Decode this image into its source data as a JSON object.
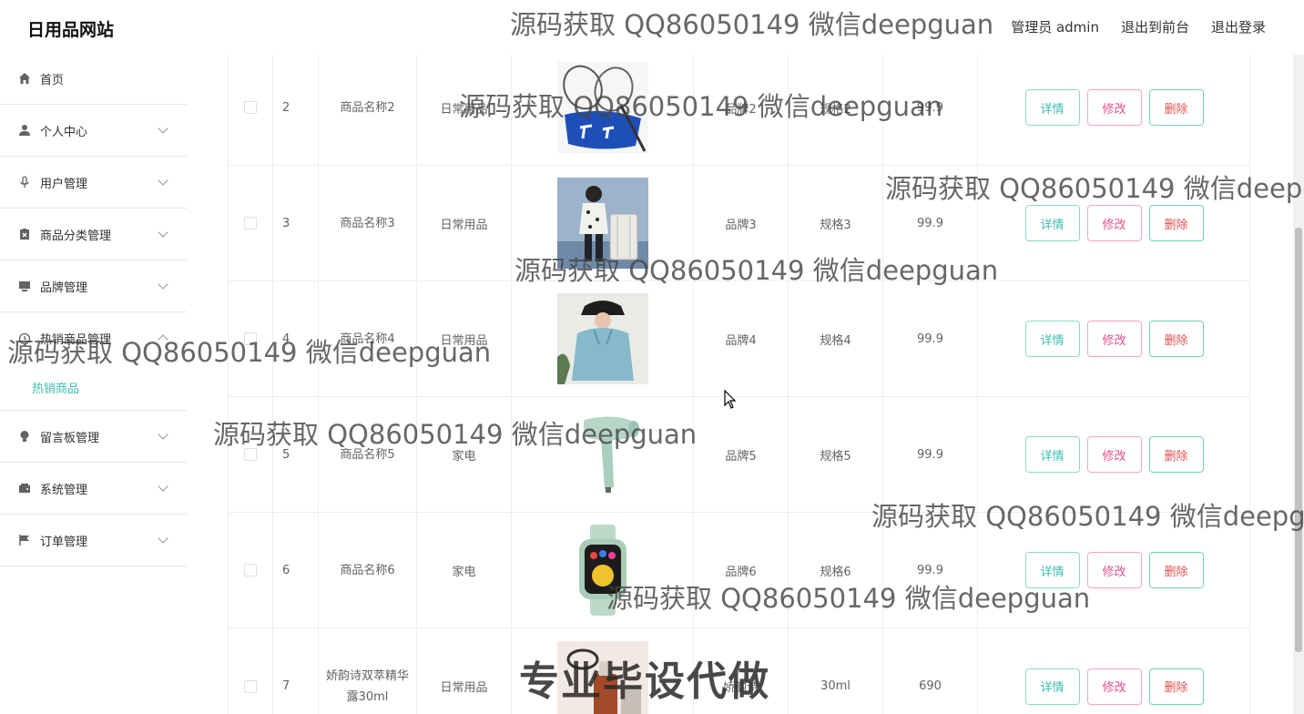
{
  "header": {
    "site_title": "日用品网站",
    "admin_label": "管理员 admin",
    "front_link": "退出到前台",
    "logout_link": "退出登录"
  },
  "sidebar": {
    "items": [
      {
        "label": "首页",
        "icon": "home-icon"
      },
      {
        "label": "个人中心",
        "icon": "user-icon"
      },
      {
        "label": "用户管理",
        "icon": "microphone-icon"
      },
      {
        "label": "商品分类管理",
        "icon": "clipboard-icon"
      },
      {
        "label": "品牌管理",
        "icon": "monitor-icon"
      },
      {
        "label": "热销商品管理",
        "icon": "clock-icon",
        "sub_items": [
          "热销商品"
        ]
      },
      {
        "label": "留言板管理",
        "icon": "lightbulb-icon"
      },
      {
        "label": "系统管理",
        "icon": "wallet-icon"
      },
      {
        "label": "订单管理",
        "icon": "flag-icon"
      }
    ]
  },
  "table": {
    "rows": [
      {
        "index": "2",
        "name": "商品名称2",
        "category": "日常用品",
        "image": "badminton-rackets",
        "brand": "品牌2",
        "spec": "规格2",
        "price": "99.9"
      },
      {
        "index": "3",
        "name": "商品名称3",
        "category": "日常用品",
        "image": "suitcase-girl",
        "brand": "品牌3",
        "spec": "规格3",
        "price": "99.9"
      },
      {
        "index": "4",
        "name": "商品名称4",
        "category": "日常用品",
        "image": "hoodie-girl",
        "brand": "品牌4",
        "spec": "规格4",
        "price": "99.9"
      },
      {
        "index": "5",
        "name": "商品名称5",
        "category": "家电",
        "image": "hair-dryer",
        "brand": "品牌5",
        "spec": "规格5",
        "price": "99.9"
      },
      {
        "index": "6",
        "name": "商品名称6",
        "category": "家电",
        "image": "smart-watch",
        "brand": "品牌6",
        "spec": "规格6",
        "price": "99.9"
      },
      {
        "index": "7",
        "name": "娇韵诗双萃精华露30ml",
        "category": "日常用品",
        "image": "serum-bottle",
        "brand": "娇韵诗",
        "spec": "30ml",
        "price": "690"
      }
    ],
    "actions": {
      "detail": "详情",
      "edit": "修改",
      "delete": "删除"
    }
  },
  "watermarks": {
    "text": "源码获取 QQ86050149 微信deepguan",
    "big_text": "专业毕设代做"
  },
  "colors": {
    "accent": "#3cbcb1",
    "edit": "#e04f8e",
    "delete": "#e0514f"
  }
}
